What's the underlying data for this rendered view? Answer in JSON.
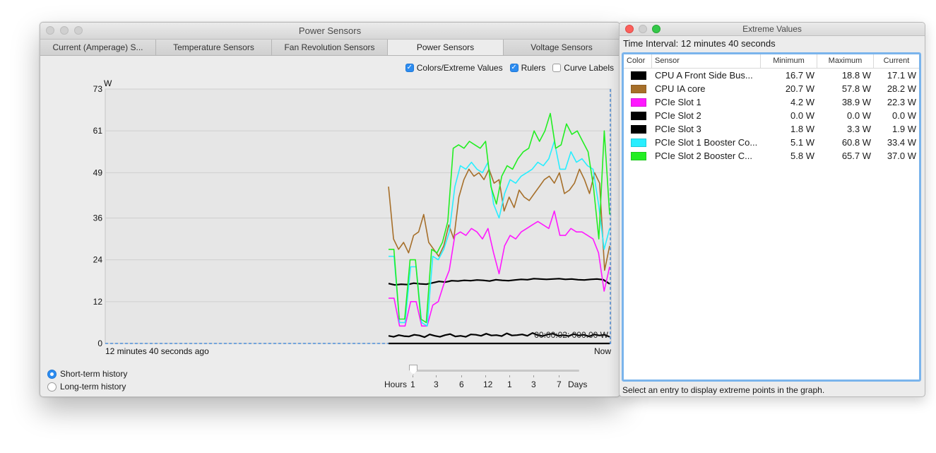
{
  "main_window": {
    "title": "Power Sensors",
    "tabs": [
      {
        "label": "Current (Amperage) S...",
        "active": false
      },
      {
        "label": "Temperature Sensors",
        "active": false
      },
      {
        "label": "Fan Revolution Sensors",
        "active": false
      },
      {
        "label": "Power Sensors",
        "active": true
      },
      {
        "label": "Voltage Sensors",
        "active": false
      }
    ],
    "options": {
      "colors_extreme": {
        "label": "Colors/Extreme Values",
        "checked": true
      },
      "rulers": {
        "label": "Rulers",
        "checked": true
      },
      "curve_labels": {
        "label": "Curve Labels",
        "checked": false
      }
    },
    "history": {
      "short_term": {
        "label": "Short-term history",
        "selected": true
      },
      "long_term": {
        "label": "Long-term history",
        "selected": false
      }
    },
    "scale": {
      "hours_label": "Hours",
      "days_label": "Days",
      "hour_ticks": [
        "1",
        "3",
        "6",
        "12"
      ],
      "day_ticks": [
        "1",
        "3",
        "7"
      ]
    }
  },
  "chart_data": {
    "type": "line",
    "y_unit_label": "W",
    "ylim": [
      0,
      73
    ],
    "y_ticks": [
      "73",
      "61",
      "49",
      "36",
      "24",
      "12",
      "0"
    ],
    "x_start_label": "12 minutes 40 seconds ago",
    "x_end_label": "Now",
    "overlay_text": "00:00:02: 000.00 W",
    "grid": true,
    "data_start_fraction": 0.56,
    "series": [
      {
        "name": "CPU A Front Side Bus...",
        "color": "#000000",
        "values": [
          17.2,
          16.8,
          17.0,
          16.9,
          17.3,
          17.1,
          17.0,
          17.4,
          17.8,
          17.6,
          18.0,
          17.9,
          18.1,
          18.0,
          18.2,
          18.1,
          17.9,
          18.3,
          18.1,
          18.0,
          18.2,
          18.4,
          18.3,
          18.6,
          18.5,
          18.4,
          18.5,
          18.6,
          18.4,
          18.5,
          18.3,
          18.2,
          18.4,
          18.5,
          18.3,
          17.1
        ]
      },
      {
        "name": "CPU IA core",
        "color": "#a66f2a",
        "values": [
          45,
          30,
          27,
          29,
          26,
          31,
          32,
          37,
          29,
          27,
          25,
          28,
          34,
          30,
          42,
          47,
          50,
          48,
          49,
          47,
          50,
          46,
          47,
          38,
          42,
          39,
          44,
          42,
          41,
          43,
          45,
          47,
          48,
          46,
          49,
          43,
          44,
          46,
          50,
          47,
          43,
          49,
          46,
          21,
          28
        ]
      },
      {
        "name": "PCIe Slot 1",
        "color": "#ff18ff",
        "values": [
          13,
          13,
          5,
          5,
          12,
          12,
          5,
          5,
          11,
          12,
          17,
          21,
          31,
          32,
          31,
          33,
          32,
          30,
          33,
          26,
          20,
          28,
          31,
          30,
          32,
          33,
          34,
          35,
          34,
          33,
          38,
          31,
          31,
          33,
          32,
          32,
          31,
          30,
          26,
          15,
          22
        ]
      },
      {
        "name": "PCIe Slot 2",
        "color": "#000000",
        "values": [
          0,
          0,
          0,
          0,
          0,
          0,
          0,
          0,
          0,
          0,
          0,
          0,
          0,
          0,
          0,
          0,
          0,
          0,
          0,
          0,
          0,
          0,
          0,
          0,
          0,
          0,
          0,
          0,
          0,
          0,
          0,
          0,
          0,
          0,
          0,
          0
        ]
      },
      {
        "name": "PCIe Slot 3",
        "color": "#000000",
        "values": [
          2.2,
          1.9,
          2.4,
          2.1,
          2.0,
          2.5,
          2.3,
          1.8,
          2.6,
          2.2,
          1.9,
          2.4,
          2.7,
          2.0,
          2.2,
          1.9,
          2.6,
          2.5,
          2.2,
          2.8,
          2.3,
          2.4,
          2.1,
          2.9,
          2.3,
          2.4,
          2.6,
          2.2,
          3.0,
          2.4,
          2.1,
          2.6,
          2.8,
          2.2,
          2.4,
          2.1,
          2.7,
          2.3,
          2.5,
          2.0,
          2.6,
          2.3,
          2.5,
          1.9
        ]
      },
      {
        "name": "PCIe Slot 1 Booster Co...",
        "color": "#28eeff",
        "values": [
          25,
          25,
          6,
          6,
          22,
          22,
          6,
          5,
          25,
          24,
          27,
          32,
          45,
          51,
          50,
          52,
          50,
          49,
          52,
          40,
          36,
          43,
          47,
          46,
          48,
          49,
          50,
          52,
          51,
          53,
          58,
          50,
          50,
          55,
          52,
          53,
          51,
          50,
          40,
          27,
          33
        ]
      },
      {
        "name": "PCIe Slot 2 Booster C...",
        "color": "#22ee22",
        "values": [
          27,
          27,
          7,
          7,
          24,
          24,
          7,
          6,
          27,
          26,
          29,
          35,
          56,
          57,
          56,
          58,
          57,
          56,
          58,
          45,
          40,
          48,
          51,
          50,
          53,
          55,
          56,
          61,
          58,
          61,
          66,
          56,
          57,
          63,
          60,
          61,
          58,
          55,
          45,
          30,
          61,
          37
        ]
      }
    ]
  },
  "extreme_values": {
    "title": "Extreme Values",
    "interval": "Time Interval: 12 minutes 40 seconds",
    "columns": [
      "Color",
      "Sensor",
      "Minimum",
      "Maximum",
      "Current"
    ],
    "rows": [
      {
        "color": "#000000",
        "sensor": "CPU A Front Side Bus...",
        "min": "16.7 W",
        "max": "18.8 W",
        "current": "17.1 W"
      },
      {
        "color": "#a66f2a",
        "sensor": "CPU IA core",
        "min": "20.7 W",
        "max": "57.8 W",
        "current": "28.2 W"
      },
      {
        "color": "#ff18ff",
        "sensor": "PCIe Slot 1",
        "min": "4.2 W",
        "max": "38.9 W",
        "current": "22.3 W"
      },
      {
        "color": "#000000",
        "sensor": "PCIe Slot 2",
        "min": "0.0 W",
        "max": "0.0 W",
        "current": "0.0 W"
      },
      {
        "color": "#000000",
        "sensor": "PCIe Slot 3",
        "min": "1.8 W",
        "max": "3.3 W",
        "current": "1.9 W"
      },
      {
        "color": "#28eeff",
        "sensor": "PCIe Slot 1 Booster Co...",
        "min": "5.1 W",
        "max": "60.8 W",
        "current": "33.4 W"
      },
      {
        "color": "#22ee22",
        "sensor": "PCIe Slot 2 Booster C...",
        "min": "5.8 W",
        "max": "65.7 W",
        "current": "37.0 W"
      }
    ],
    "footer": "Select an entry to display extreme points in the graph."
  }
}
